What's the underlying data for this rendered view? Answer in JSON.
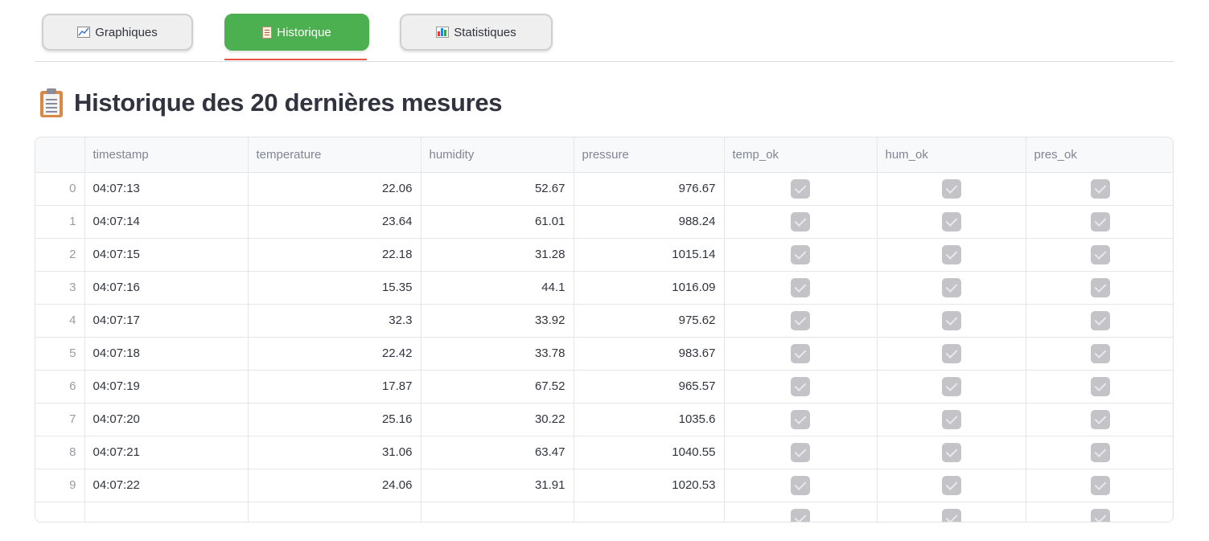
{
  "tabs": [
    {
      "label": "Graphiques",
      "icon": "chart-line-icon",
      "active": false
    },
    {
      "label": "Historique",
      "icon": "clipboard-icon",
      "active": true
    },
    {
      "label": "Statistiques",
      "icon": "bar-chart-icon",
      "active": false
    }
  ],
  "page": {
    "title": "Historique des 20 dernières mesures",
    "title_icon": "clipboard-icon"
  },
  "table": {
    "columns": [
      "",
      "timestamp",
      "temperature",
      "humidity",
      "pressure",
      "temp_ok",
      "hum_ok",
      "pres_ok"
    ],
    "rows": [
      {
        "index": "0",
        "timestamp": "04:07:13",
        "temperature": "22.06",
        "humidity": "52.67",
        "pressure": "976.67",
        "temp_ok": true,
        "hum_ok": true,
        "pres_ok": true
      },
      {
        "index": "1",
        "timestamp": "04:07:14",
        "temperature": "23.64",
        "humidity": "61.01",
        "pressure": "988.24",
        "temp_ok": true,
        "hum_ok": true,
        "pres_ok": true
      },
      {
        "index": "2",
        "timestamp": "04:07:15",
        "temperature": "22.18",
        "humidity": "31.28",
        "pressure": "1015.14",
        "temp_ok": true,
        "hum_ok": true,
        "pres_ok": true
      },
      {
        "index": "3",
        "timestamp": "04:07:16",
        "temperature": "15.35",
        "humidity": "44.1",
        "pressure": "1016.09",
        "temp_ok": true,
        "hum_ok": true,
        "pres_ok": true
      },
      {
        "index": "4",
        "timestamp": "04:07:17",
        "temperature": "32.3",
        "humidity": "33.92",
        "pressure": "975.62",
        "temp_ok": true,
        "hum_ok": true,
        "pres_ok": true
      },
      {
        "index": "5",
        "timestamp": "04:07:18",
        "temperature": "22.42",
        "humidity": "33.78",
        "pressure": "983.67",
        "temp_ok": true,
        "hum_ok": true,
        "pres_ok": true
      },
      {
        "index": "6",
        "timestamp": "04:07:19",
        "temperature": "17.87",
        "humidity": "67.52",
        "pressure": "965.57",
        "temp_ok": true,
        "hum_ok": true,
        "pres_ok": true
      },
      {
        "index": "7",
        "timestamp": "04:07:20",
        "temperature": "25.16",
        "humidity": "30.22",
        "pressure": "1035.6",
        "temp_ok": true,
        "hum_ok": true,
        "pres_ok": true
      },
      {
        "index": "8",
        "timestamp": "04:07:21",
        "temperature": "31.06",
        "humidity": "63.47",
        "pressure": "1040.55",
        "temp_ok": true,
        "hum_ok": true,
        "pres_ok": true
      },
      {
        "index": "9",
        "timestamp": "04:07:22",
        "temperature": "24.06",
        "humidity": "31.91",
        "pressure": "1020.53",
        "temp_ok": true,
        "hum_ok": true,
        "pres_ok": true
      }
    ]
  },
  "colors": {
    "active_tab": "#4caf50",
    "tab_underline": "#e8524a",
    "checkbox": "#c4c4c8"
  }
}
